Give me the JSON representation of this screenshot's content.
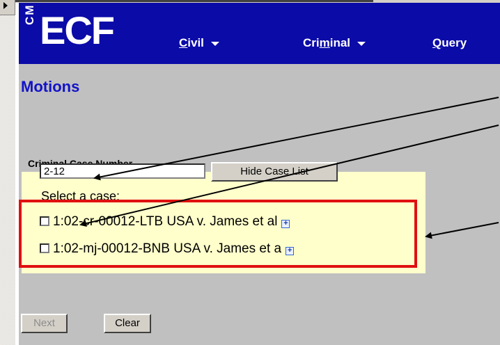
{
  "app": {
    "logo_cm": "CM",
    "logo_ecf": "ECF"
  },
  "nav": {
    "items": [
      {
        "label_pre": "",
        "label_key": "C",
        "label_post": "ivil"
      },
      {
        "label_pre": "Cri",
        "label_key": "m",
        "label_post": "inal"
      },
      {
        "label_pre": "",
        "label_key": "Q",
        "label_post": "uery"
      }
    ]
  },
  "page": {
    "title": "Motions"
  },
  "form": {
    "case_number_label": "Criminal Case Number",
    "case_number_value": "2-12",
    "hide_case_list_label": "Hide Case List",
    "select_case_label": "Select a case:",
    "cases": [
      {
        "text": "1:02-cr-00012-LTB USA v. James et al",
        "checked": false
      },
      {
        "text": "1:02-mj-00012-BNB USA v. James et a",
        "checked": false
      }
    ],
    "expand_glyph": "+",
    "next_label": "Next",
    "clear_label": "Clear"
  },
  "colors": {
    "navbar": "#0b0ba8",
    "title": "#1212c8",
    "panel": "#ffffcc",
    "highlight": "#e01010"
  }
}
